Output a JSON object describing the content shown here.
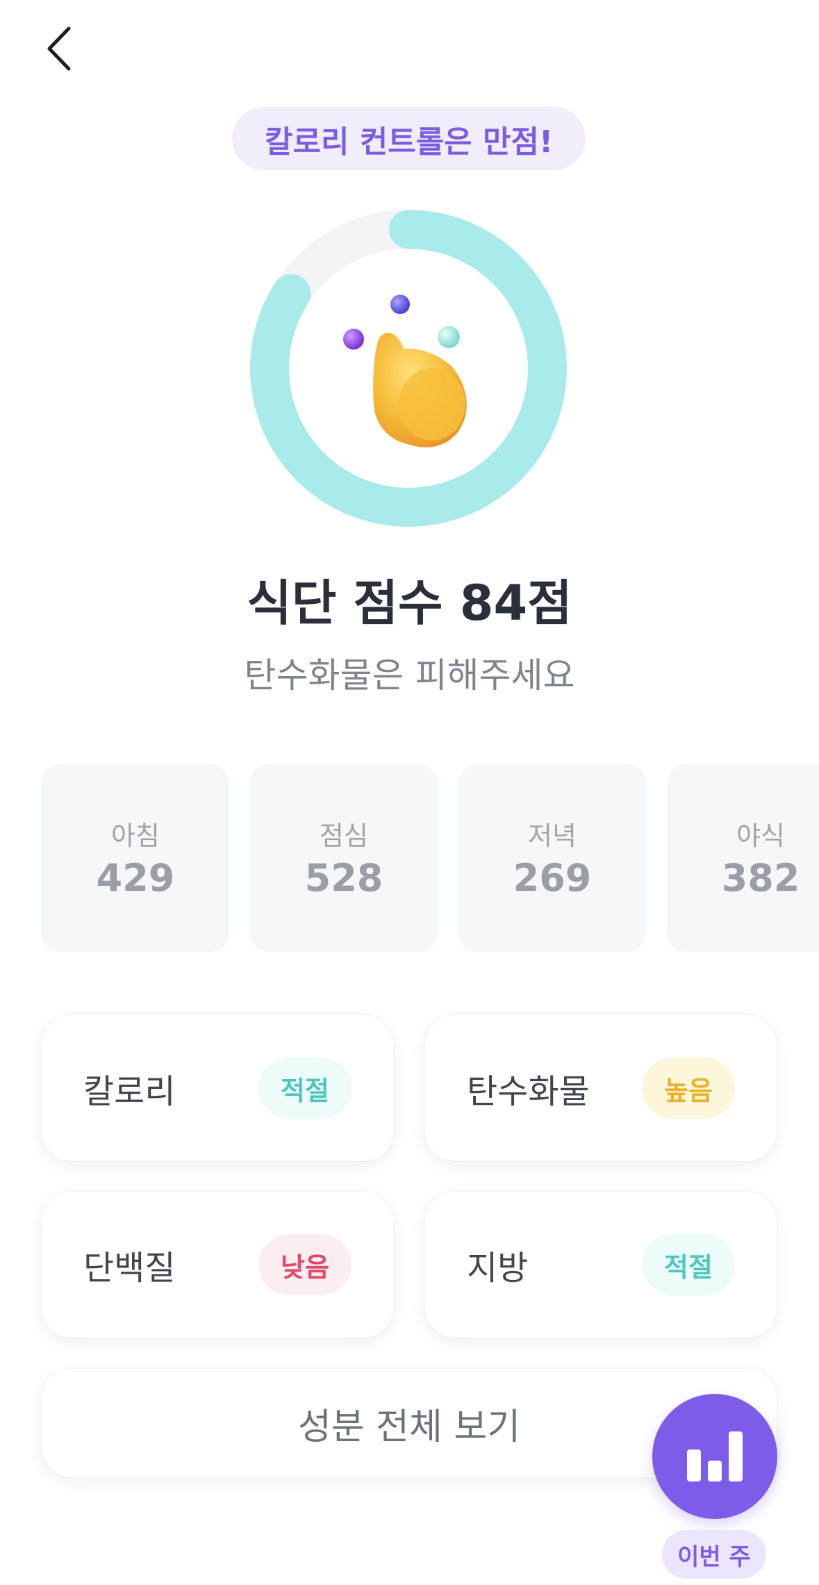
{
  "nav": {
    "back_icon": "chevron-left-icon"
  },
  "header": {
    "pill_text": "칼로리 컨트롤은 만점!"
  },
  "score": {
    "ring_progress": 0.84,
    "ring_color": "#a8ebea",
    "ring_track_color": "#f3f4f6",
    "mascot": "yellow-blob-character-with-orbs",
    "title": "식단 점수 84점",
    "subtitle": "탄수화물은 피해주세요"
  },
  "meals": [
    {
      "label": "아침",
      "value": "429"
    },
    {
      "label": "점심",
      "value": "528"
    },
    {
      "label": "저녁",
      "value": "269"
    },
    {
      "label": "야식",
      "value": "382"
    }
  ],
  "nutrients": [
    {
      "label": "칼로리",
      "status": "적절"
    },
    {
      "label": "탄수화물",
      "status": "높음"
    },
    {
      "label": "단백질",
      "status": "낮음"
    },
    {
      "label": "지방",
      "status": "적절"
    }
  ],
  "status_colors": {
    "적절": "#4fc6c0",
    "높음": "#e8b328",
    "낮음": "#e3486b"
  },
  "actions": {
    "view_all_label": "성분 전체 보기",
    "fab_icon": "bar-chart-icon",
    "week_label": "이번 주"
  },
  "accent_color": "#7c5ce8"
}
